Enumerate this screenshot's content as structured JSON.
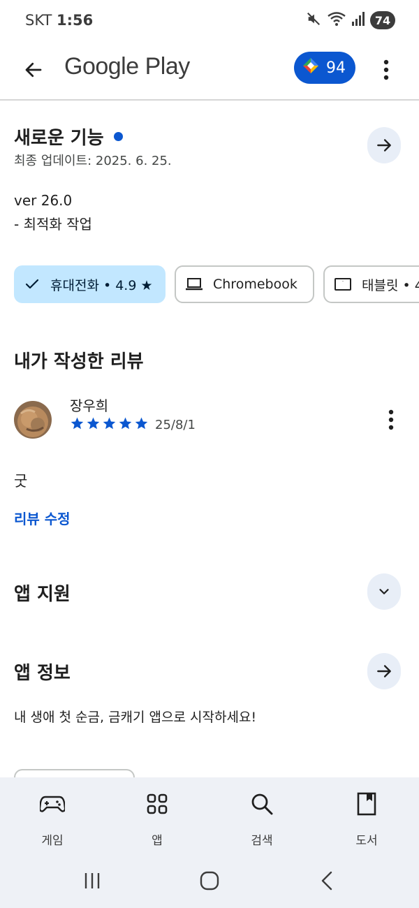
{
  "status_bar": {
    "carrier": "SKT",
    "time": "1:56",
    "battery": "74"
  },
  "app_bar": {
    "brand": "Google Play",
    "points": "94"
  },
  "whats_new": {
    "title": "새로운 기능",
    "updated": "최종 업데이트: 2025. 6. 25.",
    "version": "ver 26.0",
    "note": "- 최적화 작업"
  },
  "device_chips": [
    {
      "label": "휴대전화 • 4.9 ★",
      "selected": true,
      "icon": "check-icon"
    },
    {
      "label": "Chromebook",
      "selected": false,
      "icon": "laptop-icon"
    },
    {
      "label": "태블릿 • 4",
      "selected": false,
      "icon": "tablet-icon"
    }
  ],
  "my_review": {
    "title": "내가 작성한 리뷰",
    "reviewer": "장우희",
    "rating": 5,
    "date": "25/8/1",
    "text": "굿",
    "edit_label": "리뷰 수정"
  },
  "app_support": {
    "title": "앱 지원"
  },
  "app_info": {
    "title": "앱 정보",
    "description": "내 생애 첫 순금, 금캐기 앱으로 시작하세요!"
  },
  "bottom_nav": {
    "items": [
      {
        "label": "게임",
        "icon": "gamepad-icon"
      },
      {
        "label": "앱",
        "icon": "apps-grid-icon"
      },
      {
        "label": "검색",
        "icon": "search-icon"
      },
      {
        "label": "도서",
        "icon": "book-icon"
      }
    ]
  },
  "colors": {
    "accent": "#0b57d0",
    "chip_selected_bg": "#c2e7ff",
    "nav_bg": "#eef1f6",
    "round_button_bg": "#e8eef7"
  }
}
